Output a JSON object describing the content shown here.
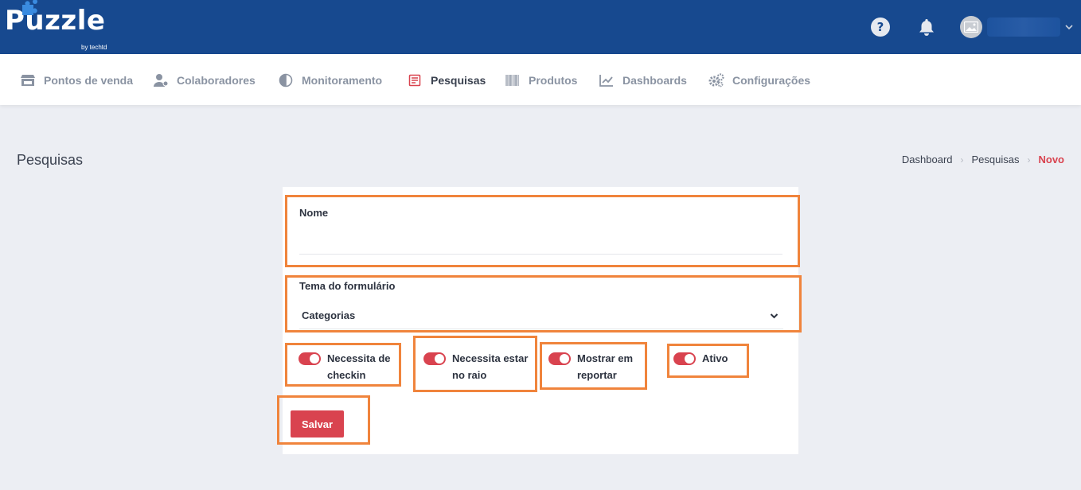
{
  "app": {
    "logo_text": "Puzzle",
    "logo_sub": "by techtd"
  },
  "header": {
    "help_icon": "question-circle-icon",
    "bell_icon": "bell-icon",
    "avatar_icon": "image-placeholder-icon"
  },
  "nav": {
    "items": [
      {
        "label": "Pontos de venda",
        "icon": "store-icon"
      },
      {
        "label": "Colaboradores",
        "icon": "user-gear-icon"
      },
      {
        "label": "Monitoramento",
        "icon": "compass-icon"
      },
      {
        "label": "Pesquisas",
        "icon": "survey-icon"
      },
      {
        "label": "Produtos",
        "icon": "barcode-icon"
      },
      {
        "label": "Dashboards",
        "icon": "chart-line-icon"
      },
      {
        "label": "Configurações",
        "icon": "gears-icon"
      }
    ],
    "active_index": 3
  },
  "page": {
    "title": "Pesquisas",
    "breadcrumb": [
      "Dashboard",
      "Pesquisas",
      "Novo"
    ]
  },
  "form": {
    "name_label": "Nome",
    "name_value": "",
    "theme_label": "Tema do formulário",
    "theme_value": "Categorias",
    "toggles": [
      {
        "label_line1": "Necessita de",
        "label_line2": "checkin",
        "on": true
      },
      {
        "label_line1": "Necessita estar",
        "label_line2": "no raio",
        "on": true
      },
      {
        "label_line1": "Mostrar em",
        "label_line2": "reportar",
        "on": true
      },
      {
        "label_line1": "Ativo",
        "label_line2": "",
        "on": true
      }
    ],
    "save_label": "Salvar"
  },
  "colors": {
    "header_bg": "#17498f",
    "accent_red": "#d9434f",
    "highlight_orange": "#f0843c",
    "page_bg": "#eceef3"
  }
}
